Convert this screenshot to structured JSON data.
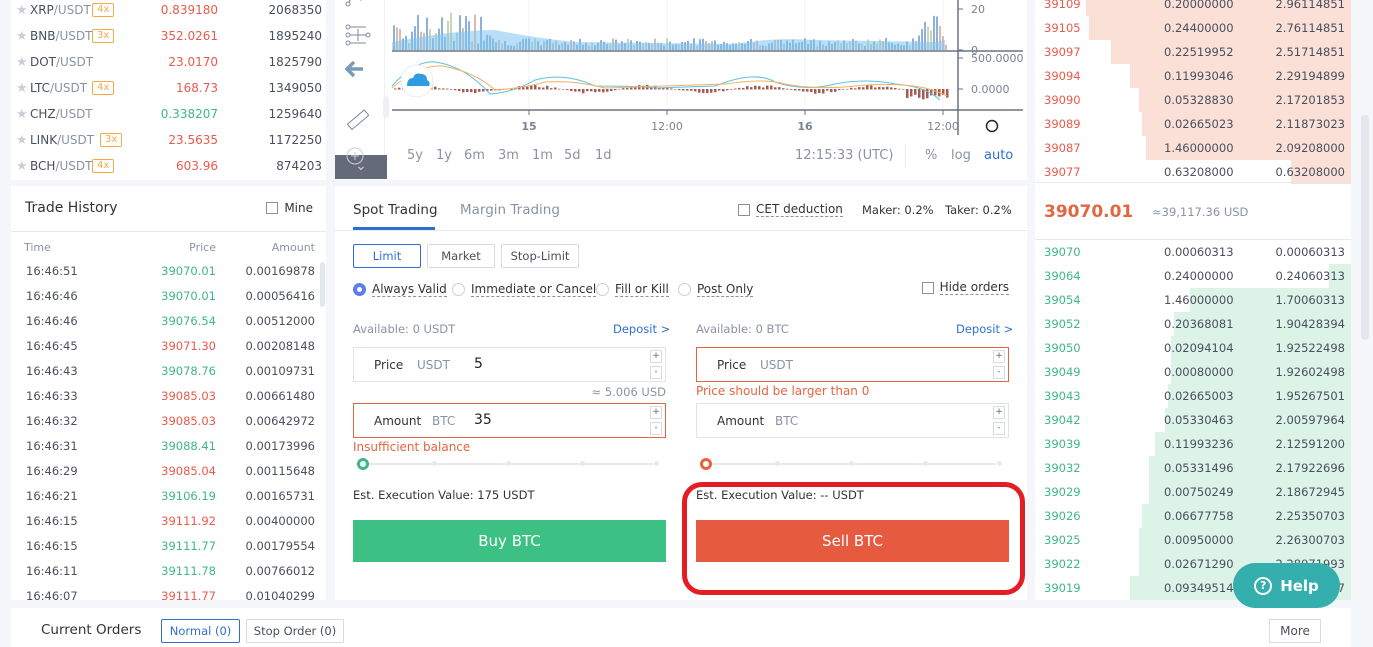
{
  "market_list": [
    {
      "base": "XRP",
      "quote": "/USDT",
      "leverage": "4x",
      "price": "0.839180",
      "direction": "down",
      "volume": "2068350"
    },
    {
      "base": "BNB",
      "quote": "/USDT",
      "leverage": "3x",
      "price": "352.0261",
      "direction": "down",
      "volume": "1895240"
    },
    {
      "base": "DOT",
      "quote": "/USDT",
      "leverage": null,
      "price": "23.0170",
      "direction": "down",
      "volume": "1825790"
    },
    {
      "base": "LTC",
      "quote": "/USDT",
      "leverage": "4x",
      "price": "168.73",
      "direction": "down",
      "volume": "1349050"
    },
    {
      "base": "CHZ",
      "quote": "/USDT",
      "leverage": null,
      "price": "0.338207",
      "direction": "up",
      "volume": "1259640"
    },
    {
      "base": "LINK",
      "quote": "/USDT",
      "leverage": "3x",
      "price": "23.5635",
      "direction": "down",
      "volume": "1172250"
    },
    {
      "base": "BCH",
      "quote": "/USDT",
      "leverage": "4x",
      "price": "603.96",
      "direction": "down",
      "volume": "874203"
    }
  ],
  "trade_history": {
    "title": "Trade History",
    "mine_label": "Mine",
    "columns": {
      "time": "Time",
      "price": "Price",
      "amount": "Amount"
    },
    "rows": [
      {
        "time": "16:46:51",
        "price": "39070.01",
        "side": "buy",
        "amount": "0.00169878"
      },
      {
        "time": "16:46:46",
        "price": "39070.01",
        "side": "buy",
        "amount": "0.00056416"
      },
      {
        "time": "16:46:46",
        "price": "39076.54",
        "side": "buy",
        "amount": "0.00512000"
      },
      {
        "time": "16:46:45",
        "price": "39071.30",
        "side": "sell",
        "amount": "0.00208148"
      },
      {
        "time": "16:46:43",
        "price": "39078.76",
        "side": "buy",
        "amount": "0.00109731"
      },
      {
        "time": "16:46:33",
        "price": "39085.03",
        "side": "sell",
        "amount": "0.00661480"
      },
      {
        "time": "16:46:32",
        "price": "39085.03",
        "side": "sell",
        "amount": "0.00642972"
      },
      {
        "time": "16:46:31",
        "price": "39088.41",
        "side": "buy",
        "amount": "0.00173996"
      },
      {
        "time": "16:46:29",
        "price": "39085.04",
        "side": "sell",
        "amount": "0.00115648"
      },
      {
        "time": "16:46:21",
        "price": "39106.19",
        "side": "buy",
        "amount": "0.00165731"
      },
      {
        "time": "16:46:15",
        "price": "39111.92",
        "side": "sell",
        "amount": "0.00400000"
      },
      {
        "time": "16:46:15",
        "price": "39111.77",
        "side": "buy",
        "amount": "0.00179554"
      },
      {
        "time": "16:46:11",
        "price": "39111.78",
        "side": "buy",
        "amount": "0.00766012"
      },
      {
        "time": "16:46:07",
        "price": "39111.77",
        "side": "sell",
        "amount": "0.01040299"
      }
    ]
  },
  "chart": {
    "toolbar_icons": [
      "pattern-tool-icon",
      "measure-range-icon",
      "back-arrow-icon",
      "ruler-icon",
      "zoom-in-icon"
    ],
    "volume_axis_ticks": [
      "20",
      "0"
    ],
    "macd_axis_ticks": [
      "500.0000",
      "0.0000"
    ],
    "time_ticks": [
      "15",
      "12:00",
      "16",
      "12:00"
    ],
    "ranges": [
      "5y",
      "1y",
      "6m",
      "3m",
      "1m",
      "5d",
      "1d"
    ],
    "clock": "12:15:33 (UTC)",
    "scale_options": [
      "%",
      "log",
      "auto"
    ],
    "active_scale": "auto"
  },
  "trading": {
    "tabs": [
      "Spot Trading",
      "Margin Trading"
    ],
    "active_tab": "Spot Trading",
    "cet_deduction_label": "CET deduction",
    "maker_fee": "Maker: 0.2%",
    "taker_fee": "Taker: 0.2%",
    "order_types": [
      "Limit",
      "Market",
      "Stop-Limit"
    ],
    "active_order_type": "Limit",
    "time_in_force": [
      "Always Valid",
      "Immediate or Cancel",
      "Fill or Kill",
      "Post Only"
    ],
    "selected_time_in_force": "Always Valid",
    "hide_orders_label": "Hide orders",
    "buy": {
      "available": "Available: 0 USDT",
      "deposit": "Deposit >",
      "price_label": "Price",
      "price_unit": "USDT",
      "price_value": "5",
      "price_usd": "≈ 5.006 USD",
      "amount_label": "Amount",
      "amount_unit": "BTC",
      "amount_value": "35",
      "error": "Insufficient balance",
      "slider_percent": 0,
      "est_value": "Est. Execution Value: 175 USDT",
      "button": "Buy BTC"
    },
    "sell": {
      "available": "Available: 0 BTC",
      "deposit": "Deposit >",
      "price_label": "Price",
      "price_unit": "USDT",
      "price_value": "",
      "error": "Price should be larger than 0",
      "amount_label": "Amount",
      "amount_unit": "BTC",
      "amount_value": "",
      "slider_percent": 0,
      "est_value": "Est. Execution Value: -- USDT",
      "button": "Sell BTC"
    },
    "stepper_plus": "+",
    "stepper_minus": "-"
  },
  "order_book": {
    "asks": [
      {
        "price": "39109",
        "amount": "0.20000000",
        "total": "2.96114851",
        "depth": 0.84
      },
      {
        "price": "39105",
        "amount": "0.24400000",
        "total": "2.76114851",
        "depth": 0.83
      },
      {
        "price": "39097",
        "amount": "0.22519952",
        "total": "2.51714851",
        "depth": 0.76
      },
      {
        "price": "39094",
        "amount": "0.11993046",
        "total": "2.29194899",
        "depth": 0.7
      },
      {
        "price": "39090",
        "amount": "0.05328830",
        "total": "2.17201853",
        "depth": 0.67
      },
      {
        "price": "39089",
        "amount": "0.02665023",
        "total": "2.11873023",
        "depth": 0.66
      },
      {
        "price": "39087",
        "amount": "1.46000000",
        "total": "2.09208000",
        "depth": 0.65
      },
      {
        "price": "39077",
        "amount": "0.63208000",
        "total": "0.63208000",
        "depth": 0.19
      }
    ],
    "last_price": "39070.01",
    "last_price_usd": "≈39,117.36 USD",
    "bids": [
      {
        "price": "39070",
        "amount": "0.00060313",
        "total": "0.00060313",
        "depth": 0.0
      },
      {
        "price": "39064",
        "amount": "0.24000000",
        "total": "0.24060313",
        "depth": 0.07
      },
      {
        "price": "39054",
        "amount": "1.46000000",
        "total": "1.70060313",
        "depth": 0.51
      },
      {
        "price": "39052",
        "amount": "0.20368081",
        "total": "1.90428394",
        "depth": 0.56
      },
      {
        "price": "39050",
        "amount": "0.02094104",
        "total": "1.92522498",
        "depth": 0.57
      },
      {
        "price": "39049",
        "amount": "0.00080000",
        "total": "1.92602498",
        "depth": 0.57
      },
      {
        "price": "39043",
        "amount": "0.02665003",
        "total": "1.95267501",
        "depth": 0.58
      },
      {
        "price": "39042",
        "amount": "0.05330463",
        "total": "2.00597964",
        "depth": 0.59
      },
      {
        "price": "39039",
        "amount": "0.11993236",
        "total": "2.12591200",
        "depth": 0.62
      },
      {
        "price": "39032",
        "amount": "0.05331496",
        "total": "2.17922696",
        "depth": 0.64
      },
      {
        "price": "39029",
        "amount": "0.00750249",
        "total": "2.18672945",
        "depth": 0.64
      },
      {
        "price": "39026",
        "amount": "0.06677758",
        "total": "2.25350703",
        "depth": 0.66
      },
      {
        "price": "39025",
        "amount": "0.00950000",
        "total": "2.26300703",
        "depth": 0.67
      },
      {
        "price": "39022",
        "amount": "0.02671290",
        "total": "2.28971993",
        "depth": 0.67
      },
      {
        "price": "39019",
        "amount": "0.09349514",
        "total": "2.38321507",
        "depth": 0.7
      }
    ]
  },
  "help_button": "Help",
  "current_orders": {
    "title": "Current Orders",
    "tabs": [
      "Normal (0)",
      "Stop Order (0)"
    ],
    "active_tab": "Normal (0)",
    "more": "More"
  },
  "colors": {
    "up": "#3fb787",
    "down": "#e85a4a",
    "accent": "#2f6fd1",
    "buy_button": "#3cc083",
    "sell_button": "#e65a40",
    "ask_depth": "#fbe0d8",
    "bid_depth": "#dcf3e8",
    "highlight": "#e41d25"
  }
}
